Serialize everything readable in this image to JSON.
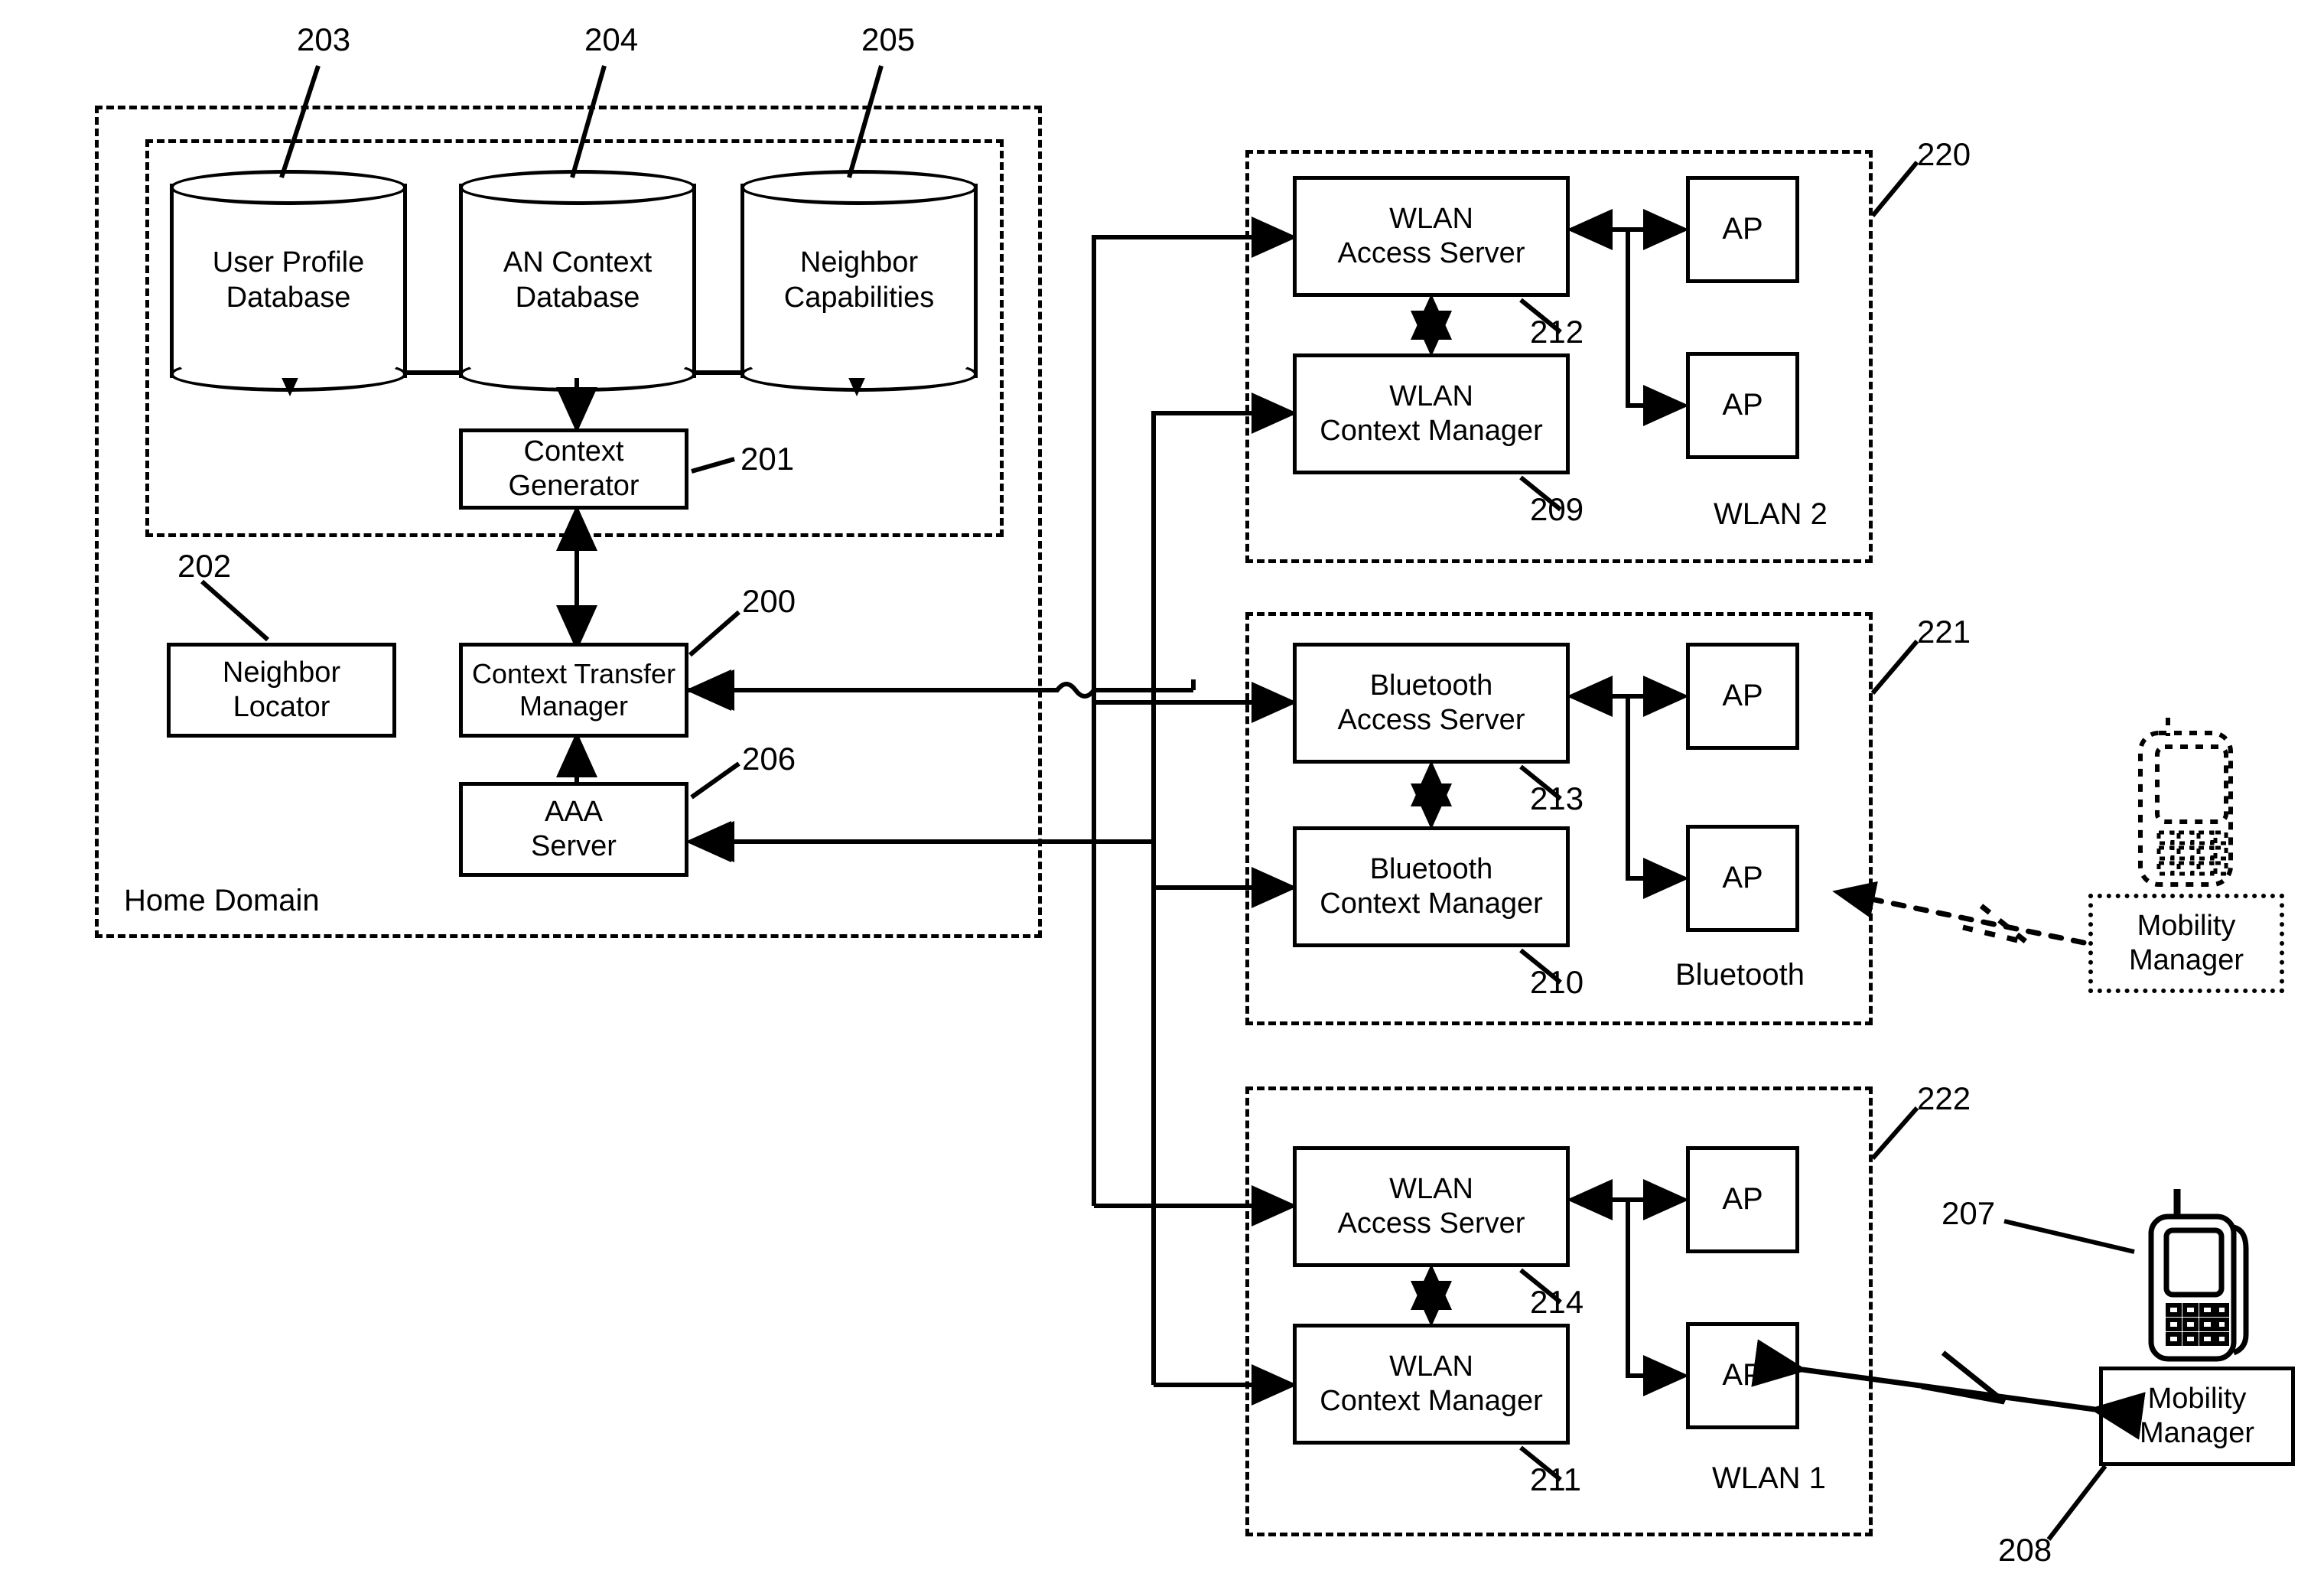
{
  "figure": {
    "domains": {
      "home_domain_label": "Home Domain",
      "wlan2_label": "WLAN 2",
      "bluetooth_label": "Bluetooth",
      "wlan1_label": "WLAN 1"
    },
    "databases": [
      {
        "id": "203",
        "line1": "User Profile",
        "line2": "Database"
      },
      {
        "id": "204",
        "line1": "AN Context",
        "line2": "Database"
      },
      {
        "id": "205",
        "line1": "Neighbor",
        "line2": "Capabilities"
      }
    ],
    "home_blocks": [
      {
        "id": "201",
        "line1": "Context",
        "line2": "Generator"
      },
      {
        "id": "202",
        "line1": "Neighbor",
        "line2": "Locator"
      },
      {
        "id": "200",
        "line1": "Context Transfer",
        "line2": "Manager"
      },
      {
        "id": "206",
        "line1": "AAA",
        "line2": "Server"
      }
    ],
    "networks": [
      {
        "id": "220",
        "name": "WLAN 2",
        "access_server": {
          "id": "212",
          "line1": "WLAN",
          "line2": "Access Server"
        },
        "context_manager": {
          "id": "209",
          "line1": "WLAN",
          "line2": "Context Manager"
        },
        "aps": [
          "AP",
          "AP"
        ]
      },
      {
        "id": "221",
        "name": "Bluetooth",
        "access_server": {
          "id": "213",
          "line1": "Bluetooth",
          "line2": "Access Server"
        },
        "context_manager": {
          "id": "210",
          "line1": "Bluetooth",
          "line2": "Context Manager"
        },
        "aps": [
          "AP",
          "AP"
        ]
      },
      {
        "id": "222",
        "name": "WLAN 1",
        "access_server": {
          "id": "214",
          "line1": "WLAN",
          "line2": "Access Server"
        },
        "context_manager": {
          "id": "211",
          "line1": "WLAN",
          "line2": "Context Manager"
        },
        "aps": [
          "AP",
          "AP"
        ]
      }
    ],
    "terminals": [
      {
        "id": "",
        "style": "ghost",
        "mobility_manager": {
          "line1": "Mobility",
          "line2": "Manager"
        }
      },
      {
        "id": "207",
        "style": "solid",
        "mobility_manager": {
          "id": "208",
          "line1": "Mobility",
          "line2": "Manager"
        }
      }
    ],
    "reference_numerals": [
      "200",
      "201",
      "202",
      "203",
      "204",
      "205",
      "206",
      "207",
      "208",
      "209",
      "210",
      "211",
      "212",
      "213",
      "214",
      "220",
      "221",
      "222"
    ],
    "colors": {
      "ink": "#000000",
      "paper": "#ffffff"
    }
  }
}
